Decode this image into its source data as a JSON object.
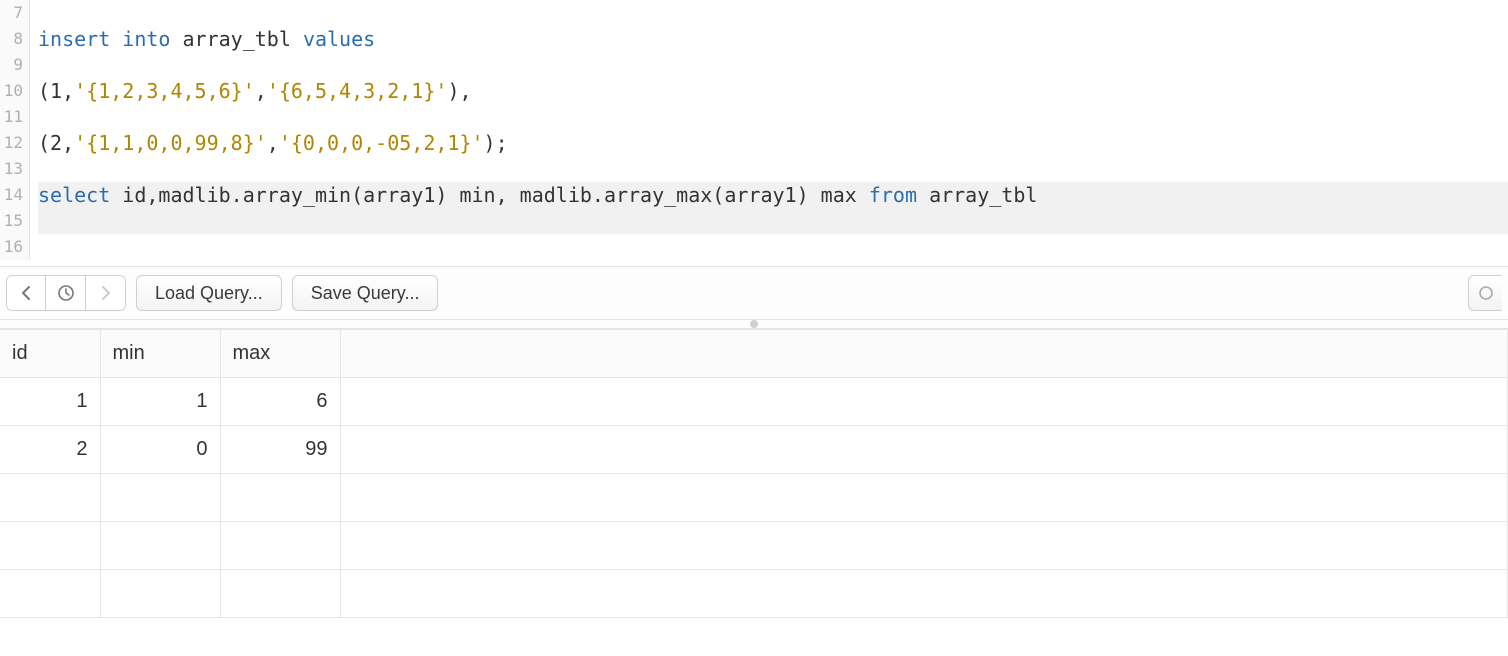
{
  "editor": {
    "line_numbers": [
      "7",
      "8",
      "9",
      "10",
      "11",
      "12",
      "13",
      "14",
      "15",
      "16"
    ],
    "lines": [
      {
        "tokens": []
      },
      {
        "tokens": [
          {
            "t": "insert ",
            "c": "kw"
          },
          {
            "t": "into ",
            "c": "kw"
          },
          {
            "t": "array_tbl ",
            "c": "ident"
          },
          {
            "t": "values",
            "c": "kw"
          }
        ]
      },
      {
        "tokens": []
      },
      {
        "tokens": [
          {
            "t": "(",
            "c": "punct"
          },
          {
            "t": "1",
            "c": "num"
          },
          {
            "t": ",",
            "c": "punct"
          },
          {
            "t": "'{1,2,3,4,5,6}'",
            "c": "str"
          },
          {
            "t": ",",
            "c": "punct"
          },
          {
            "t": "'{6,5,4,3,2,1}'",
            "c": "str"
          },
          {
            "t": "),",
            "c": "punct"
          }
        ]
      },
      {
        "tokens": []
      },
      {
        "tokens": [
          {
            "t": "(",
            "c": "punct"
          },
          {
            "t": "2",
            "c": "num"
          },
          {
            "t": ",",
            "c": "punct"
          },
          {
            "t": "'{1,1,0,0,99,8}'",
            "c": "str"
          },
          {
            "t": ",",
            "c": "punct"
          },
          {
            "t": "'{0,0,0,-05,2,1}'",
            "c": "str"
          },
          {
            "t": ");",
            "c": "punct"
          }
        ]
      },
      {
        "tokens": []
      },
      {
        "highlight": true,
        "tokens": [
          {
            "t": "select ",
            "c": "kw"
          },
          {
            "t": "id,madlib.array_min(array1) min, madlib.array_max(array1) max ",
            "c": "func"
          },
          {
            "t": "from ",
            "c": "kw"
          },
          {
            "t": "array_tbl",
            "c": "ident"
          }
        ]
      },
      {
        "highlight": true,
        "tokens": []
      },
      {
        "tokens": []
      }
    ]
  },
  "toolbar": {
    "load_label": "Load Query...",
    "save_label": "Save Query..."
  },
  "results": {
    "columns": [
      "id",
      "min",
      "max"
    ],
    "rows": [
      {
        "id": "1",
        "min": "1",
        "max": "6"
      },
      {
        "id": "2",
        "min": "0",
        "max": "99"
      }
    ],
    "empty_rows": 3
  }
}
